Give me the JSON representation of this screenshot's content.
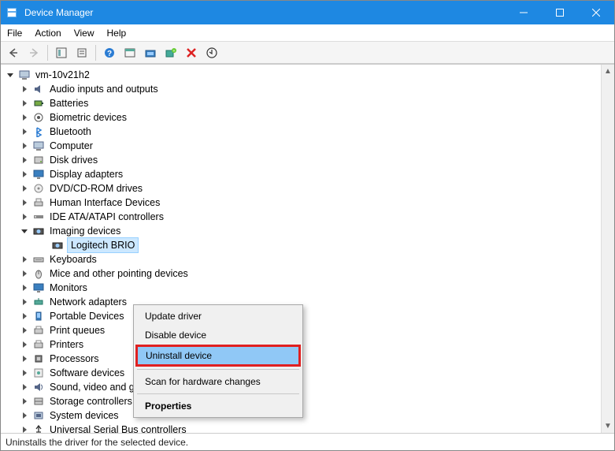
{
  "window": {
    "title": "Device Manager"
  },
  "menu": {
    "file": "File",
    "action": "Action",
    "view": "View",
    "help": "Help"
  },
  "tree": {
    "root": "vm-10v21h2",
    "categories": [
      {
        "label": "Audio inputs and outputs"
      },
      {
        "label": "Batteries"
      },
      {
        "label": "Biometric devices"
      },
      {
        "label": "Bluetooth"
      },
      {
        "label": "Computer"
      },
      {
        "label": "Disk drives"
      },
      {
        "label": "Display adapters"
      },
      {
        "label": "DVD/CD-ROM drives"
      },
      {
        "label": "Human Interface Devices"
      },
      {
        "label": "IDE ATA/ATAPI controllers"
      },
      {
        "label": "Imaging devices",
        "expanded": true,
        "children": [
          {
            "label": "Logitech BRIO",
            "selected": true
          }
        ]
      },
      {
        "label": "Keyboards"
      },
      {
        "label": "Mice and other pointing devices"
      },
      {
        "label": "Monitors"
      },
      {
        "label": "Network adapters"
      },
      {
        "label": "Portable Devices"
      },
      {
        "label": "Print queues"
      },
      {
        "label": "Printers"
      },
      {
        "label": "Processors"
      },
      {
        "label": "Software devices"
      },
      {
        "label": "Sound, video and game controllers"
      },
      {
        "label": "Storage controllers"
      },
      {
        "label": "System devices"
      },
      {
        "label": "Universal Serial Bus controllers"
      }
    ]
  },
  "context_menu": {
    "update": "Update driver",
    "disable": "Disable device",
    "uninstall": "Uninstall device",
    "scan": "Scan for hardware changes",
    "properties": "Properties"
  },
  "status": "Uninstalls the driver for the selected device."
}
